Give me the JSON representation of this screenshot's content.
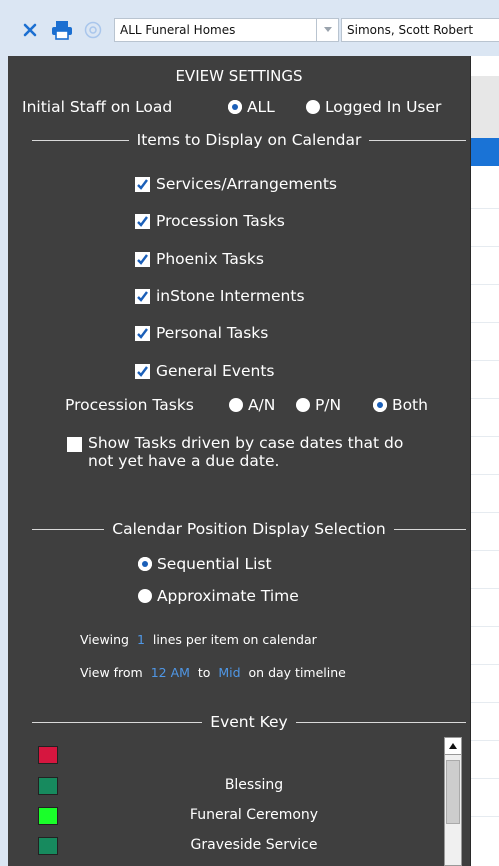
{
  "toolbar": {
    "funeral_home_select": "ALL Funeral Homes",
    "staff_select": "Simons, Scott Robert"
  },
  "panel": {
    "title": "EVIEW SETTINGS",
    "initial_staff": {
      "label": "Initial Staff on Load",
      "options": [
        "ALL",
        "Logged In User"
      ],
      "selected": "ALL"
    },
    "items_section": "Items to Display on Calendar",
    "items": [
      {
        "label": "Services/Arrangements",
        "checked": true
      },
      {
        "label": "Procession Tasks",
        "checked": true
      },
      {
        "label": "Phoenix Tasks",
        "checked": true
      },
      {
        "label": "inStone Interments",
        "checked": true
      },
      {
        "label": "Personal Tasks",
        "checked": true
      },
      {
        "label": "General Events",
        "checked": true
      }
    ],
    "procession": {
      "label": "Procession Tasks",
      "options": [
        "A/N",
        "P/N",
        "Both"
      ],
      "selected": "Both"
    },
    "show_tasks": {
      "line1": "Show Tasks driven by case dates that do",
      "line2": "not yet have a due date.",
      "checked": false
    },
    "position_section": "Calendar Position Display Selection",
    "position_options": [
      "Sequential List",
      "Approximate Time"
    ],
    "position_selected": "Sequential List",
    "viewing": {
      "prefix": "Viewing",
      "value": "1",
      "suffix": "lines per item on calendar"
    },
    "view_from": {
      "prefix": "View from",
      "from": "12 AM",
      "to_word": "to",
      "to": "Mid",
      "suffix": "on day timeline"
    },
    "event_key_section": "Event Key",
    "event_key": [
      {
        "label": "",
        "color": "#d6163f"
      },
      {
        "label": "Blessing",
        "color": "#178a5e"
      },
      {
        "label": "Funeral Ceremony",
        "color": "#1aff2a"
      },
      {
        "label": "Graveside Service",
        "color": "#178a5e"
      }
    ]
  }
}
